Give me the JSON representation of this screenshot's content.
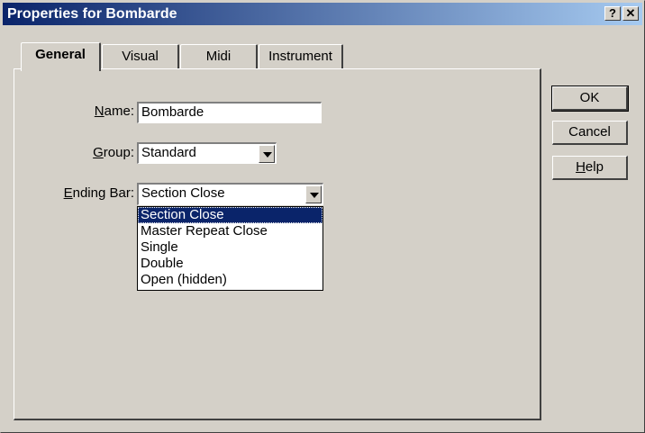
{
  "window": {
    "title": "Properties for Bombarde",
    "help_glyph": "?",
    "close_glyph": "✕"
  },
  "tabs": [
    {
      "label": "General",
      "active": true
    },
    {
      "label": "Visual",
      "active": false
    },
    {
      "label": "Midi",
      "active": false
    },
    {
      "label": "Instrument",
      "active": false
    }
  ],
  "fields": {
    "name": {
      "label_key": "N",
      "label_rest": "ame:",
      "value": "Bombarde"
    },
    "group": {
      "label_key": "G",
      "label_rest": "roup:",
      "value": "Standard"
    },
    "ending_bar": {
      "label_key": "E",
      "label_rest": "nding Bar:",
      "value": "Section Close"
    }
  },
  "dropdown_options": [
    {
      "label": "Section Close",
      "selected": true
    },
    {
      "label": "Master Repeat Close",
      "selected": false
    },
    {
      "label": "Single",
      "selected": false
    },
    {
      "label": "Double",
      "selected": false
    },
    {
      "label": "Open (hidden)",
      "selected": false
    }
  ],
  "buttons": {
    "ok": "OK",
    "cancel": "Cancel",
    "help_key": "H",
    "help_rest": "elp"
  },
  "colors": {
    "titlebar_start": "#0a246a",
    "titlebar_end": "#a6caf0",
    "dialog_face": "#d4d0c8",
    "selection": "#0a246a"
  }
}
